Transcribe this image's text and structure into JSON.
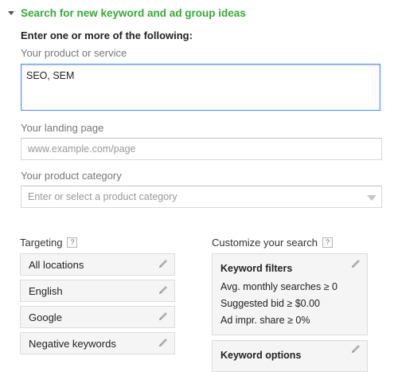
{
  "section": {
    "title": "Search for new keyword and ad group ideas"
  },
  "instructions": "Enter one or more of the following:",
  "product": {
    "label": "Your product or service",
    "value": "SEO, SEM"
  },
  "landing": {
    "label": "Your landing page",
    "placeholder": "www.example.com/page"
  },
  "category": {
    "label": "Your product category",
    "placeholder": "Enter or select a product category"
  },
  "targeting": {
    "title": "Targeting",
    "help": "?",
    "items": [
      {
        "label": "All locations"
      },
      {
        "label": "English"
      },
      {
        "label": "Google"
      },
      {
        "label": "Negative keywords"
      }
    ]
  },
  "customize": {
    "title": "Customize your search",
    "help": "?",
    "keyword_filters": {
      "title": "Keyword filters",
      "lines": [
        "Avg. monthly searches ≥ 0",
        "Suggested bid ≥ $0.00",
        "Ad impr. share ≥ 0%"
      ]
    },
    "keyword_options": {
      "title": "Keyword options"
    }
  },
  "colors": {
    "section_title": "#38a83a",
    "focus_border": "#4d90fe"
  },
  "icons": {
    "collapse": "triangle-down-icon",
    "edit": "pencil-icon",
    "help": "question-icon"
  }
}
